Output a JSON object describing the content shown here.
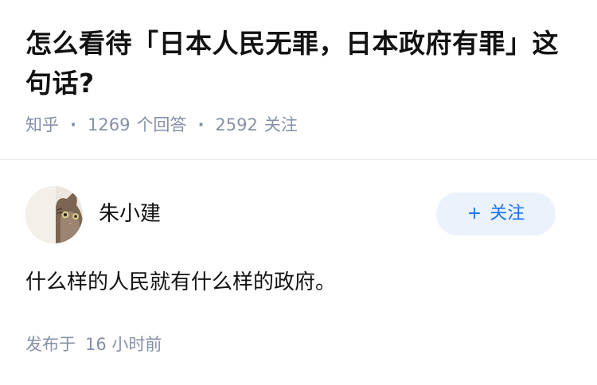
{
  "question": {
    "title": "怎么看待「日本人民无罪，日本政府有罪」这句话?",
    "source": "知乎",
    "answer_count": "1269",
    "answer_label": "个回答",
    "follower_count": "2592",
    "follower_label": "关注"
  },
  "answer": {
    "author": {
      "name": "朱小建",
      "avatar_icon": "cat-avatar-icon"
    },
    "follow_button": {
      "plus": "+",
      "label": "关注"
    },
    "content": "什么样的人民就有什么样的政府。",
    "time": {
      "prefix": "发布于",
      "value": "16 小时前"
    }
  },
  "colors": {
    "text_primary": "#121212",
    "text_secondary": "#8590a6",
    "follow_bg": "#ebf2fc",
    "follow_text": "#1772f6",
    "divider": "#ebebeb"
  }
}
